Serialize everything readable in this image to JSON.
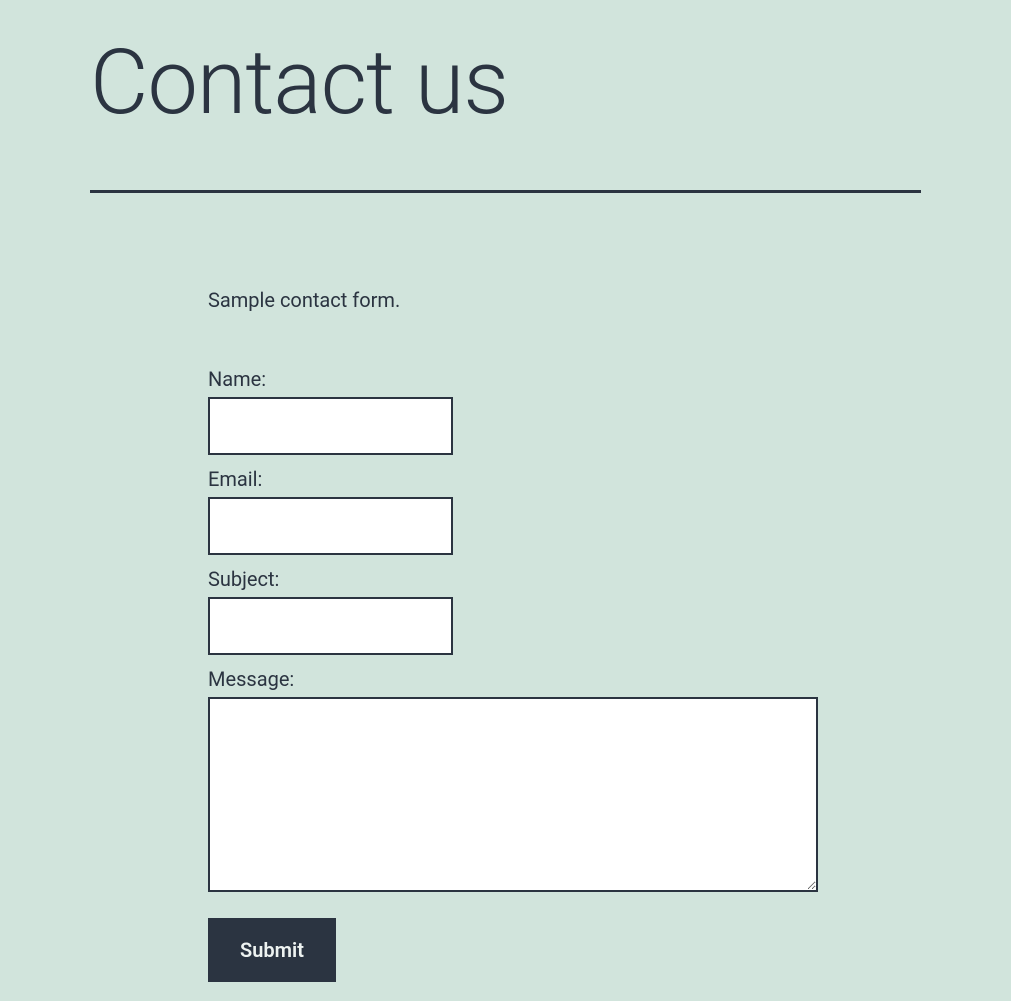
{
  "header": {
    "title": "Contact us"
  },
  "content": {
    "intro": "Sample contact form."
  },
  "form": {
    "name": {
      "label": "Name:",
      "value": ""
    },
    "email": {
      "label": "Email:",
      "value": ""
    },
    "subject": {
      "label": "Subject:",
      "value": ""
    },
    "message": {
      "label": "Message:",
      "value": ""
    },
    "submit_label": "Submit"
  }
}
